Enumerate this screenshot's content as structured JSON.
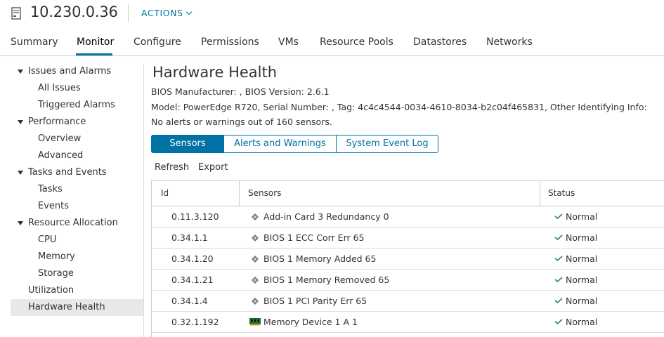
{
  "header": {
    "host": "10.230.0.36",
    "actions_label": "ACTIONS",
    "host_icon": "host-server-icon"
  },
  "tabs": [
    {
      "label": "Summary"
    },
    {
      "label": "Monitor",
      "active": true
    },
    {
      "label": "Configure"
    },
    {
      "label": "Permissions"
    },
    {
      "label": "VMs"
    },
    {
      "label": "Resource Pools"
    },
    {
      "label": "Datastores"
    },
    {
      "label": "Networks"
    }
  ],
  "sidebar": {
    "sections": [
      {
        "label": "Issues and Alarms",
        "items": [
          "All Issues",
          "Triggered Alarms"
        ]
      },
      {
        "label": "Performance",
        "items": [
          "Overview",
          "Advanced"
        ]
      },
      {
        "label": "Tasks and Events",
        "items": [
          "Tasks",
          "Events"
        ]
      },
      {
        "label": "Resource Allocation",
        "items": [
          "CPU",
          "Memory",
          "Storage"
        ]
      }
    ],
    "utilization": "Utilization",
    "hardware_health": "Hardware Health"
  },
  "main": {
    "title": "Hardware Health",
    "bios_line": "BIOS Manufacturer: , BIOS Version: 2.6.1",
    "model_line": "Model: PowerEdge R720, Serial Number: , Tag: 4c4c4544-0034-4610-8034-b2c04f465831, Other Identifying Info:",
    "alerts_line": "No alerts or warnings out of 160 sensors.",
    "segments": [
      "Sensors",
      "Alerts and Warnings",
      "System Event Log"
    ],
    "toolbar": {
      "refresh": "Refresh",
      "export": "Export"
    },
    "table": {
      "columns": [
        "Id",
        "Sensors",
        "Status"
      ],
      "rows": [
        {
          "id": "0.11.3.120",
          "sensor": "Add-in Card 3 Redundancy 0",
          "status": "Normal",
          "icon": "sensor-icon"
        },
        {
          "id": "0.34.1.1",
          "sensor": "BIOS 1 ECC Corr Err 65",
          "status": "Normal",
          "icon": "sensor-icon"
        },
        {
          "id": "0.34.1.20",
          "sensor": "BIOS 1 Memory Added 65",
          "status": "Normal",
          "icon": "sensor-icon"
        },
        {
          "id": "0.34.1.21",
          "sensor": "BIOS 1 Memory Removed 65",
          "status": "Normal",
          "icon": "sensor-icon"
        },
        {
          "id": "0.34.1.4",
          "sensor": "BIOS 1 PCI Parity Err 65",
          "status": "Normal",
          "icon": "sensor-icon"
        },
        {
          "id": "0.32.1.192",
          "sensor": "Memory Device 1 A 1",
          "status": "Normal",
          "icon": "memory-module-icon"
        }
      ]
    }
  },
  "colors": {
    "accent": "#0072a3",
    "ok": "#2e8540",
    "selected_bg": "#e8e8e8"
  }
}
